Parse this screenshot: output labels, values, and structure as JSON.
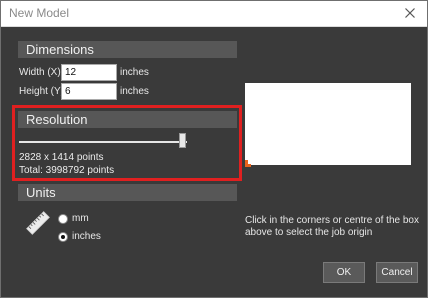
{
  "window": {
    "title": "New Model"
  },
  "dimensions": {
    "header": "Dimensions",
    "width_label": "Width (X)",
    "width_value": "12",
    "width_unit": "inches",
    "height_label": "Height (Y)",
    "height_value": "6",
    "height_unit": "inches"
  },
  "resolution": {
    "header": "Resolution",
    "slider_level": 0.97,
    "points": "2828 x 1414 points",
    "total": "Total: 3998792 points"
  },
  "units": {
    "header": "Units",
    "options": [
      {
        "label": "mm",
        "checked": false
      },
      {
        "label": "inches",
        "checked": true
      }
    ]
  },
  "preview": {
    "hint": "Click in the corners or centre of the box above to select the job origin",
    "origin_color": "#e8641e"
  },
  "buttons": {
    "ok": "OK",
    "cancel": "Cancel"
  },
  "colors": {
    "highlight": "#e02020",
    "background": "#3a3a3a",
    "section_header": "#575757"
  }
}
